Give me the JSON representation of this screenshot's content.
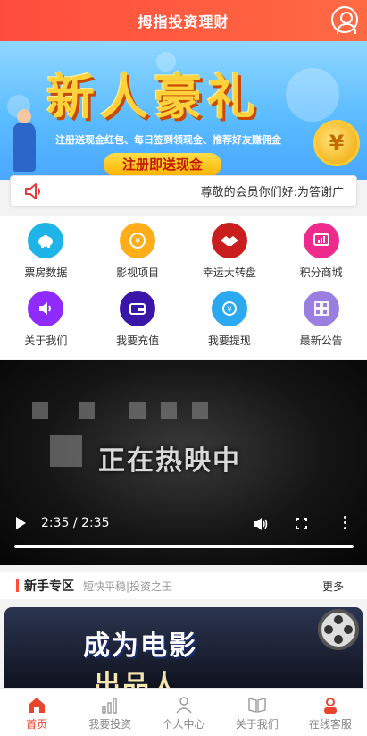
{
  "header": {
    "title": "拇指投资理财",
    "avatar_icon": "user-icon"
  },
  "banner": {
    "headline": "新人豪礼",
    "subtext": "注册送现金红包、每日签到领现金、推荐好友赚佣金",
    "cta": "注册即送现金",
    "coin_symbol": "¥"
  },
  "notice": {
    "icon": "speaker-icon",
    "text": "尊敬的会员你们好:为答谢广"
  },
  "menu": {
    "items": [
      {
        "label": "票房数据",
        "icon": "piggy-bank-icon",
        "color": "#1fb4e8"
      },
      {
        "label": "影视项目",
        "icon": "coin-exchange-icon",
        "color": "#ffae1a"
      },
      {
        "label": "幸运大转盘",
        "icon": "handshake-icon",
        "color": "#c81e1e"
      },
      {
        "label": "积分商城",
        "icon": "chart-screen-icon",
        "color": "#ee2b8c"
      },
      {
        "label": "关于我们",
        "icon": "speaker-icon",
        "color": "#8f2bff"
      },
      {
        "label": "我要充值",
        "icon": "wallet-icon",
        "color": "#3a16a8"
      },
      {
        "label": "我要提现",
        "icon": "withdraw-icon",
        "color": "#2aa8f0"
      },
      {
        "label": "最新公告",
        "icon": "grid-icon",
        "color": "#9a7fe0"
      }
    ]
  },
  "video": {
    "title": "正在热映中",
    "time": "2:35 / 2:35",
    "progress": 1.0
  },
  "section": {
    "title": "新手专区",
    "subtitle": "短快平稳|投资之王",
    "more": "更多"
  },
  "promo": {
    "line1": "成为电影",
    "line2": "出品人"
  },
  "tabbar": {
    "tabs": [
      {
        "label": "首页",
        "icon": "home-icon",
        "active": true
      },
      {
        "label": "我要投资",
        "icon": "bar-chart-icon",
        "active": false
      },
      {
        "label": "个人中心",
        "icon": "person-icon",
        "active": false
      },
      {
        "label": "关于我们",
        "icon": "book-icon",
        "active": false
      },
      {
        "label": "在线客服",
        "icon": "support-agent-icon",
        "active": false
      }
    ],
    "active_color": "#e8442e",
    "inactive_color": "#888888"
  }
}
